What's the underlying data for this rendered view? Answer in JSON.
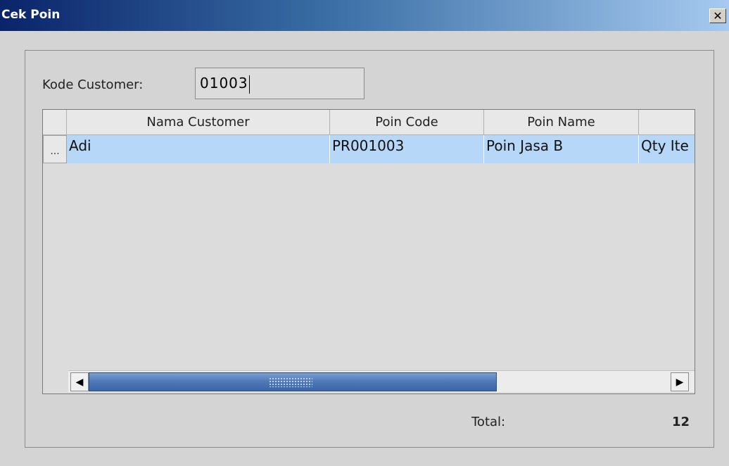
{
  "window": {
    "title": "Cek Poin",
    "close_symbol": "✕"
  },
  "form": {
    "kode_label": "Kode Customer:",
    "kode_value": "01003"
  },
  "table": {
    "columns": [
      "Nama Customer",
      "Poin Code",
      "Poin Name",
      ""
    ],
    "rows": [
      {
        "row_marker": "...",
        "cells": [
          "Adi",
          "PR001003",
          "Poin Jasa B",
          "Qty Ite"
        ]
      }
    ]
  },
  "scrollbar": {
    "left_arrow": "◀",
    "right_arrow": "▶"
  },
  "footer": {
    "total_label": "Total:",
    "total_value": "12"
  },
  "colors": {
    "title_gradient_start": "#0a246a",
    "title_gradient_end": "#a6caf0",
    "selected_row": "#b6d7f7",
    "scroll_thumb": "#4d78b8"
  }
}
